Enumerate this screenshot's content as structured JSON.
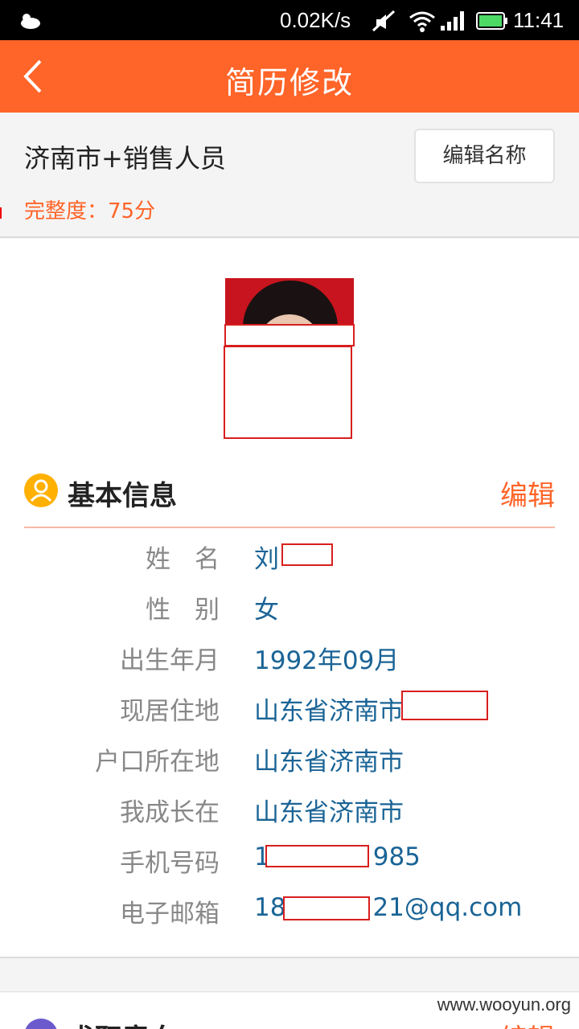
{
  "status_bar": {
    "speed": "0.02K/s",
    "time": "11:41",
    "icons": [
      "weather-icon",
      "mute-icon",
      "wifi-icon",
      "signal-icon",
      "battery-icon"
    ]
  },
  "titlebar": {
    "title": "简历修改"
  },
  "resume": {
    "name": "济南市+销售人员",
    "completeness": "完整度：75分",
    "edit_name_label": "编辑名称"
  },
  "basic_info": {
    "title": "基本信息",
    "edit_label": "编辑",
    "rows": [
      {
        "key": "姓名",
        "value": "刘"
      },
      {
        "key": "性别",
        "value": "女"
      },
      {
        "key": "出生年月",
        "value": "1992年09月"
      },
      {
        "key": "现居住地",
        "value": "山东省济南市"
      },
      {
        "key": "户口所在地",
        "value": "山东省济南市"
      },
      {
        "key": "我成长在",
        "value": "山东省济南市"
      },
      {
        "key": "手机号码",
        "value_prefix": "1",
        "value_suffix": "985"
      },
      {
        "key": "电子邮箱",
        "value_prefix": "18",
        "value_suffix": "21@qq.com"
      }
    ]
  },
  "next_section": {
    "title": "求职意向",
    "edit_label": "编辑"
  },
  "watermark": "www.wooyun.org",
  "colors": {
    "accent": "#ff6428",
    "value_text": "#1a6496",
    "redaction_border": "#d81e1e"
  }
}
